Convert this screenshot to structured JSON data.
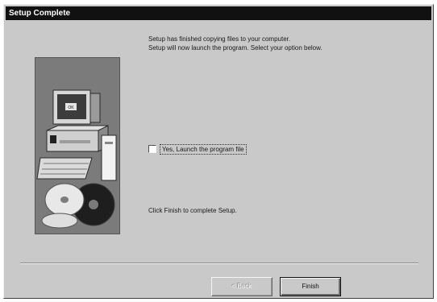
{
  "window": {
    "title": "Setup Complete"
  },
  "message": {
    "line1": "Setup has finished copying files to your computer.",
    "line2": "Setup will now launch the program. Select your option below."
  },
  "checkbox": {
    "label": "Yes, Launch the program file",
    "checked": false
  },
  "finish_instruction": "Click Finish to complete Setup.",
  "buttons": {
    "back": "< Back",
    "finish": "Finish"
  },
  "graphic": {
    "icon": "computer-and-cd-illustration",
    "screen_label": "OK"
  }
}
